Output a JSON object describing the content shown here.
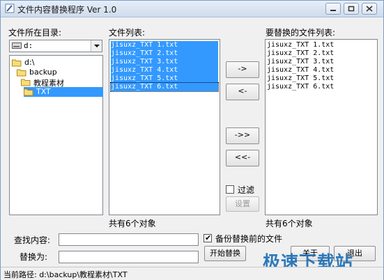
{
  "window": {
    "title": "文件内容替换程序 Ver 1.0"
  },
  "left": {
    "label": "文件所在目录:",
    "drive_value": "d:",
    "tree": [
      {
        "text": "d:\\"
      },
      {
        "text": "backup"
      },
      {
        "text": "教程素材"
      },
      {
        "text": "TXT"
      }
    ]
  },
  "middle": {
    "label": "文件列表:",
    "files": [
      "jisuxz_TXT 1.txt",
      "jisuxz_TXT 2.txt",
      "jisuxz_TXT 3.txt",
      "jisuxz_TXT 4.txt",
      "jisuxz_TXT 5.txt",
      "jisuxz_TXT 6.txt"
    ],
    "count_text": "共有6个对象"
  },
  "buttons": {
    "add_one": "->",
    "remove_one": "<-",
    "add_all": "->>",
    "remove_all": "<<-",
    "filter_label": "过滤",
    "settings": "设置",
    "start_replace": "开始替换",
    "about": "关于",
    "exit": "退出"
  },
  "right": {
    "label": "要替换的文件列表:",
    "files": [
      "jisuxz_TXT 1.txt",
      "jisuxz_TXT 2.txt",
      "jisuxz_TXT 3.txt",
      "jisuxz_TXT 4.txt",
      "jisuxz_TXT 5.txt",
      "jisuxz_TXT 6.txt"
    ],
    "count_text": "共有6个对象"
  },
  "form": {
    "find_label": "查找内容:",
    "find_value": "",
    "replace_label": "替换为:",
    "replace_value": "",
    "backup_label": "备份替换前的文件",
    "backup_checked": true
  },
  "status": {
    "path_text": "当前路径: d:\\backup\\教程素材\\TXT"
  },
  "watermark": "极速下载站"
}
